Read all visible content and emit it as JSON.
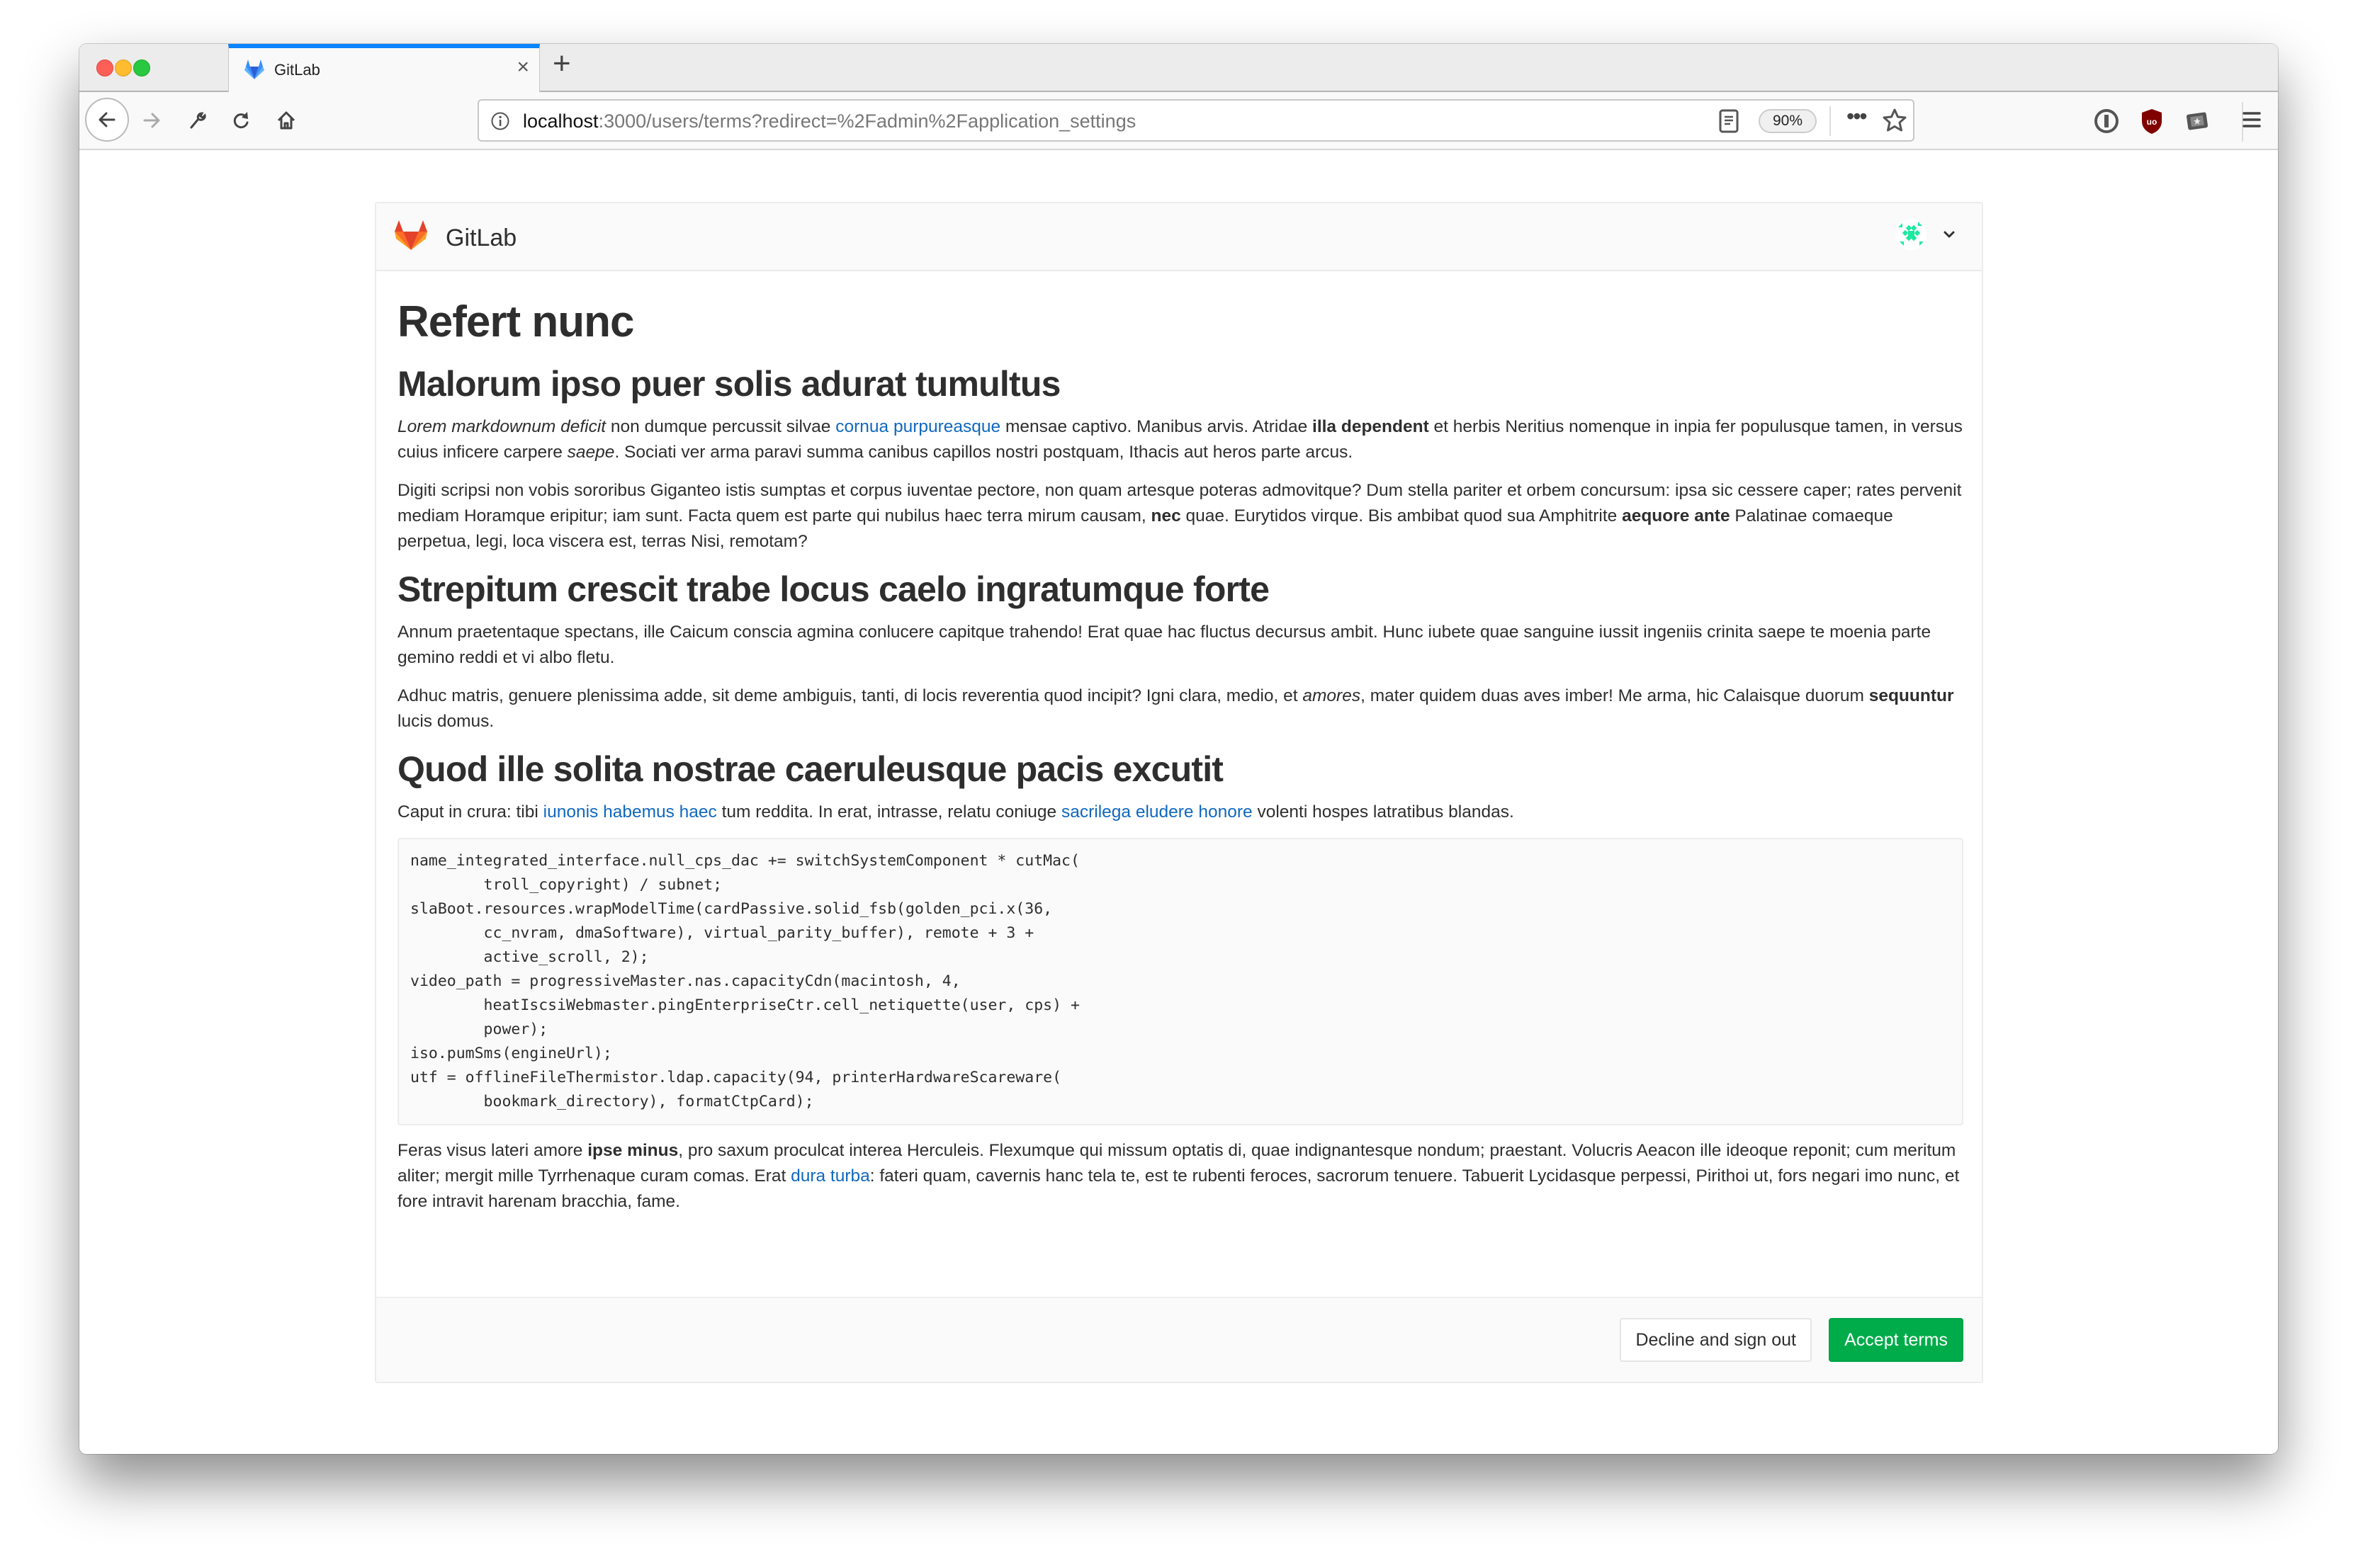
{
  "browser": {
    "tab": {
      "title": "GitLab",
      "favicon": "gitlab-logo-icon"
    },
    "new_tab_label": "+",
    "close_tab_label": "×",
    "address": {
      "host": "localhost",
      "rest": ":3000/users/terms?redirect=%2Fadmin%2Fapplication_settings"
    },
    "zoom_level": "90%",
    "page_actions_label": "•••",
    "icons": [
      "back-icon",
      "forward-icon",
      "wrench-icon",
      "reload-icon",
      "home-icon",
      "info-icon",
      "reader-view-icon",
      "bookmark-star-icon",
      "1password-icon",
      "ublock-origin-icon",
      "screenshot-icon",
      "hamburger-menu-icon"
    ]
  },
  "header": {
    "brand": "GitLab",
    "colors": {
      "logo_orange": "#fc6d26",
      "logo_red": "#e24329",
      "logo_yellow": "#fca326"
    }
  },
  "content": {
    "title": "Refert nunc",
    "sections": [
      {
        "heading": "Malorum ipso puer solis adurat tumultus",
        "p1": {
          "em1": "Lorem markdownum deficit",
          "t1": " non dumque percussit silvae ",
          "link1": "cornua purpureasque",
          "t2": " mensae captivo. Manibus arvis. Atridae ",
          "b1": "illa dependent",
          "t3": " et herbis Neritius nomenque in inpia fer populusque tamen, in versus cuius inficere carpere ",
          "em2": "saepe",
          "t4": ". Sociati ver arma paravi summa canibus capillos nostri postquam, Ithacis aut heros parte arcus."
        },
        "p2": {
          "t1": "Digiti scripsi non vobis sororibus Giganteo istis sumptas et corpus iuventae pectore, non quam artesque poteras admovitque? Dum stella pariter et orbem concursum: ipsa sic cessere caper; rates pervenit mediam Horamque eripitur; iam sunt. Facta quem est parte qui nubilus haec terra mirum causam, ",
          "b1": "nec",
          "t2": " quae. Eurytidos virque. Bis ambibat quod sua Amphitrite ",
          "b2": "aequore ante",
          "t3": " Palatinae comaeque perpetua, legi, loca viscera est, terras Nisi, remotam?"
        }
      },
      {
        "heading": "Strepitum crescit trabe locus caelo ingratumque forte",
        "p1": {
          "t1": "Annum praetentaque spectans, ille Caicum conscia agmina conlucere capitque trahendo! Erat quae hac fluctus decursus ambit. Hunc iubete quae sanguine iussit ingeniis crinita saepe te moenia parte gemino reddi et vi albo fletu."
        },
        "p2": {
          "t1": "Adhuc matris, genuere plenissima adde, sit deme ambiguis, tanti, di locis reverentia quod incipit? Igni clara, medio, et ",
          "em1": "amores",
          "t2": ", mater quidem duas aves imber! Me arma, hic Calaisque duorum ",
          "b1": "sequuntur",
          "t3": " lucis domus."
        }
      },
      {
        "heading": "Quod ille solita nostrae caeruleusque pacis excutit",
        "p1": {
          "t1": "Caput in crura: tibi ",
          "link1": "iunonis habemus haec",
          "t2": " tum reddita. In erat, intrasse, relatu coniuge ",
          "link2": "sacrilega eludere honore",
          "t3": " volenti hospes latratibus blandas."
        },
        "code": "name_integrated_interface.null_cps_dac += switchSystemComponent * cutMac(\n        troll_copyright) / subnet;\nslaBoot.resources.wrapModelTime(cardPassive.solid_fsb(golden_pci.x(36,\n        cc_nvram, dmaSoftware), virtual_parity_buffer), remote + 3 +\n        active_scroll, 2);\nvideo_path = progressiveMaster.nas.capacityCdn(macintosh, 4,\n        heatIscsiWebmaster.pingEnterpriseCtr.cell_netiquette(user, cps) +\n        power);\niso.pumSms(engineUrl);\nutf = offlineFileThermistor.ldap.capacity(94, printerHardwareScareware(\n        bookmark_directory), formatCtpCard);",
        "p2": {
          "t1": "Feras visus lateri amore ",
          "b1": "ipse minus",
          "t2": ", pro saxum proculcat interea Herculeis. Flexumque qui missum optatis di, quae indignantesque nondum; praestant. Volucris Aeacon ille ideoque reponit; cum meritum aliter; mergit mille Tyrrhenaque curam comas. Erat ",
          "link1": "dura turba",
          "t3": ": fateri quam, cavernis hanc tela te, est te rubenti feroces, sacrorum tenuere. Tabuerit Lycidasque perpessi, Pirithoi ut, fors negari imo nunc, et fore intravit harenam bracchia, fame."
        }
      }
    ]
  },
  "footer": {
    "decline_label": "Decline and sign out",
    "accept_label": "Accept terms",
    "colors": {
      "accept_bg": "#00ac4a",
      "link": "#1068bf"
    }
  }
}
